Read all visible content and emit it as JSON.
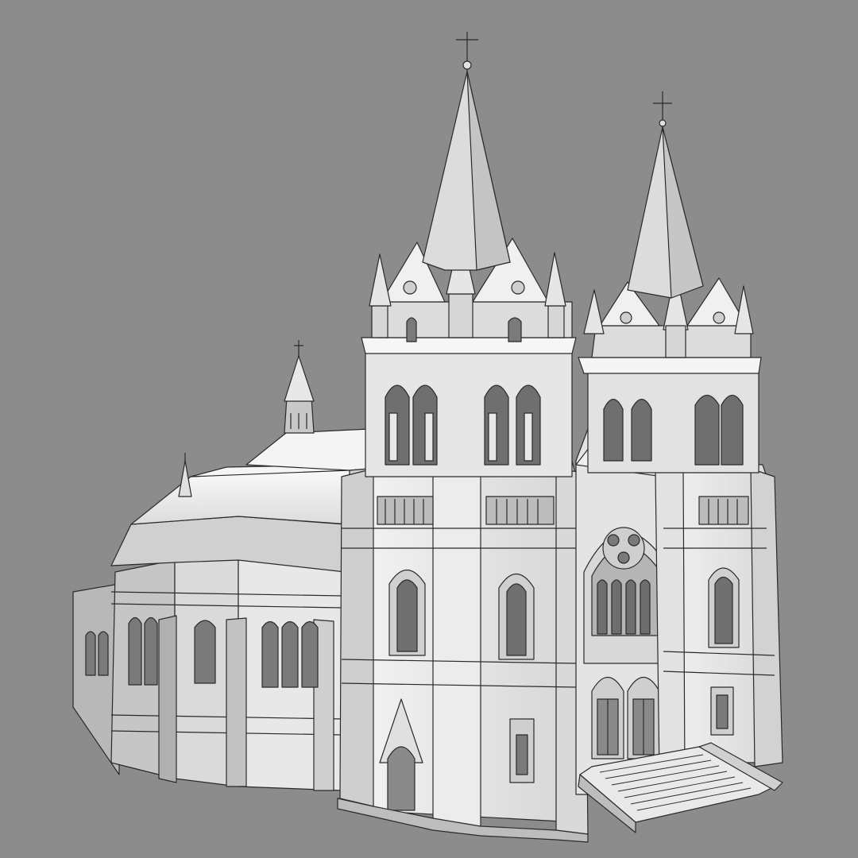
{
  "scene": {
    "subject": "gothic-church-3d-model",
    "background_color": "#8c8c8c",
    "model_color": "#e6e6e6",
    "shadow_color": "#9a9a9a",
    "edge_color": "#2a2a2a"
  }
}
